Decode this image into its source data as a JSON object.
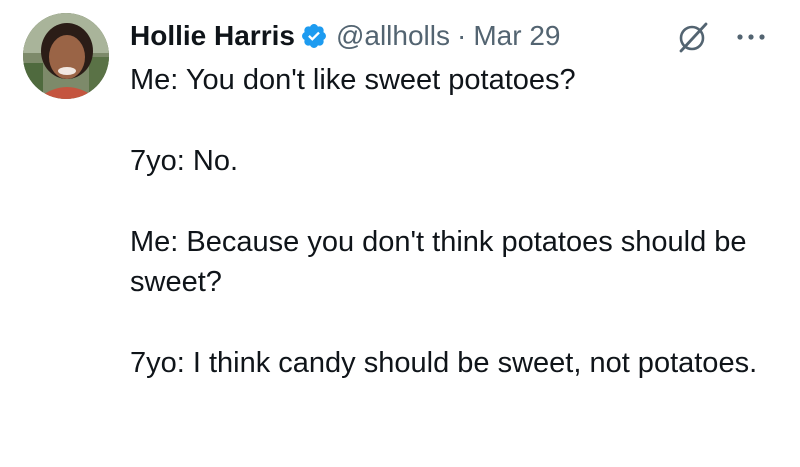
{
  "author": {
    "display_name": "Hollie Harris",
    "handle": "@allholls",
    "separator": "·",
    "date": "Mar 29",
    "verified": true
  },
  "icons": {
    "verified": "verified-badge-icon",
    "grok": "grok-icon",
    "more": "more-options-icon"
  },
  "colors": {
    "text": "#0f1419",
    "secondary": "#536471",
    "verified": "#1d9bf0"
  },
  "tweet": {
    "paragraphs": [
      "Me: You don't like sweet potatoes?",
      "7yo: No.",
      "Me: Because you don't think potatoes should be sweet?",
      "7yo: I think candy should be sweet, not potatoes."
    ]
  }
}
